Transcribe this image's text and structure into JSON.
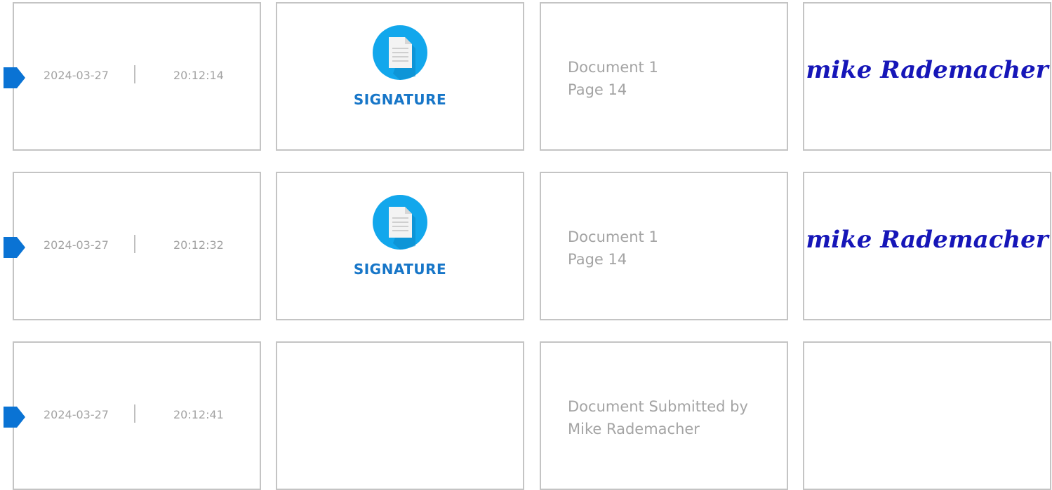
{
  "colors": {
    "accent": "#1776c8",
    "marker": "#0a73d4",
    "icon_circle": "#12a7ec",
    "card_border": "#c4c4c4",
    "muted_text": "#a3a3a3",
    "signature_ink": "#1616b8"
  },
  "rows": [
    {
      "date": "2024-03-27",
      "time": "20:12:14",
      "event_icon": "document-icon",
      "event_type": "SIGNATURE",
      "description_line1": "Document 1",
      "description_line2": "Page 14",
      "signature_text": "mike Rademacher"
    },
    {
      "date": "2024-03-27",
      "time": "20:12:32",
      "event_icon": "document-icon",
      "event_type": "SIGNATURE",
      "description_line1": "Document 1",
      "description_line2": "Page 14",
      "signature_text": "mike Rademacher"
    },
    {
      "date": "2024-03-27",
      "time": "20:12:41",
      "event_icon": "",
      "event_type": "",
      "description_line1": "Document Submitted by",
      "description_line2": "Mike Rademacher",
      "signature_text": ""
    }
  ]
}
